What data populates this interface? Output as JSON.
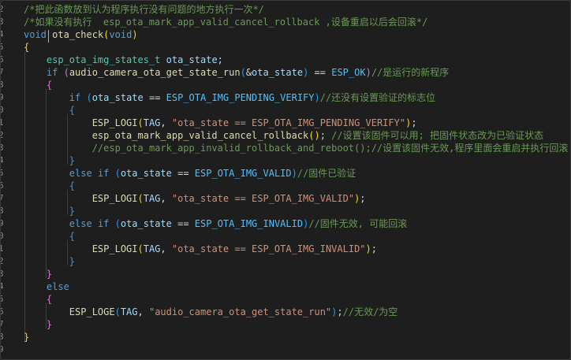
{
  "editor": {
    "language": "c",
    "function_name": "ota_check",
    "colors": {
      "background": "#1e1e1e",
      "keyword": "#569cd6",
      "function": "#dcdcaa",
      "type": "#4ec9b0",
      "variable": "#9cdcfe",
      "constant": "#4fc1ff",
      "string": "#ce9178",
      "comment": "#6a9955",
      "bracket_level1": "#ffd700",
      "bracket_level2": "#da70d6",
      "bracket_level3": "#179fff"
    },
    "gutter": [
      "2",
      "3",
      "4",
      "5",
      "6",
      "7",
      "8",
      "9",
      "0",
      "1",
      "2",
      "3",
      "4",
      "5",
      "6",
      "7",
      "8",
      "9",
      "0",
      "1",
      "2",
      "3",
      "4",
      "5",
      "6",
      "7",
      "8",
      "9"
    ],
    "lines": [
      [
        {
          "t": "/*把此函数放到认为程序执行没有问题的地方执行一次*/",
          "c": "cm"
        }
      ],
      [
        {
          "t": "/*如果没有执行  esp_ota_mark_app_valid_cancel_rollback ,设备重启以后会回滚*/",
          "c": "cm"
        }
      ],
      [
        {
          "t": "void",
          "c": "kw"
        },
        {
          "t": " "
        },
        {
          "t": "ota_check",
          "c": "fn"
        },
        {
          "t": "(",
          "c": "br1"
        },
        {
          "t": "void",
          "c": "kw"
        },
        {
          "t": ")",
          "c": "br1"
        }
      ],
      [
        {
          "t": "{",
          "c": "br1"
        }
      ],
      [
        {
          "t": "    "
        },
        {
          "t": "esp_ota_img_states_t",
          "c": "ty"
        },
        {
          "t": " "
        },
        {
          "t": "ota_state",
          "c": "var"
        },
        {
          "t": ";"
        }
      ],
      [
        {
          "t": "    "
        },
        {
          "t": "if",
          "c": "kw"
        },
        {
          "t": " "
        },
        {
          "t": "(",
          "c": "br2"
        },
        {
          "t": "audio_camera_ota_get_state_run",
          "c": "fn"
        },
        {
          "t": "(",
          "c": "br3"
        },
        {
          "t": "&"
        },
        {
          "t": "ota_state",
          "c": "var"
        },
        {
          "t": ")",
          "c": "br3"
        },
        {
          "t": " == "
        },
        {
          "t": "ESP_OK",
          "c": "mac"
        },
        {
          "t": ")",
          "c": "br2"
        },
        {
          "t": "//是运行的新程序",
          "c": "cm"
        }
      ],
      [
        {
          "t": "    "
        },
        {
          "t": "{",
          "c": "br2"
        }
      ],
      [
        {
          "t": "        "
        },
        {
          "t": "if",
          "c": "kw"
        },
        {
          "t": " "
        },
        {
          "t": "(",
          "c": "br3"
        },
        {
          "t": "ota_state",
          "c": "var"
        },
        {
          "t": " == "
        },
        {
          "t": "ESP_OTA_IMG_PENDING_VERIFY",
          "c": "mac"
        },
        {
          "t": ")",
          "c": "br3"
        },
        {
          "t": "//还没有设置验证的标志位",
          "c": "cm"
        }
      ],
      [
        {
          "t": "        "
        },
        {
          "t": "{",
          "c": "br3"
        }
      ],
      [
        {
          "t": "            "
        },
        {
          "t": "ESP_LOGI",
          "c": "fn"
        },
        {
          "t": "(",
          "c": "br1"
        },
        {
          "t": "TAG",
          "c": "var"
        },
        {
          "t": ", "
        },
        {
          "t": "\"ota_state == ESP_OTA_IMG_PENDING_VERIFY\"",
          "c": "str"
        },
        {
          "t": ")",
          "c": "br1"
        },
        {
          "t": ";"
        }
      ],
      [
        {
          "t": "            "
        },
        {
          "t": "esp_ota_mark_app_valid_cancel_rollback",
          "c": "fn"
        },
        {
          "t": "(",
          "c": "br1"
        },
        {
          "t": ")",
          "c": "br1"
        },
        {
          "t": "; "
        },
        {
          "t": "//设置该固件可以用; 把固件状态改为已验证状态",
          "c": "cm"
        }
      ],
      [
        {
          "t": "            "
        },
        {
          "t": "//esp_ota_mark_app_invalid_rollback_and_reboot();//设置该固件无效,程序里面会重启并执行回滚",
          "c": "cm"
        }
      ],
      [
        {
          "t": "        "
        },
        {
          "t": "}",
          "c": "br3"
        }
      ],
      [
        {
          "t": "        "
        },
        {
          "t": "else",
          "c": "kw"
        },
        {
          "t": " "
        },
        {
          "t": "if",
          "c": "kw"
        },
        {
          "t": " "
        },
        {
          "t": "(",
          "c": "br3"
        },
        {
          "t": "ota_state",
          "c": "var"
        },
        {
          "t": " == "
        },
        {
          "t": "ESP_OTA_IMG_VALID",
          "c": "mac"
        },
        {
          "t": ")",
          "c": "br3"
        },
        {
          "t": "//固件已验证",
          "c": "cm"
        }
      ],
      [
        {
          "t": "        "
        },
        {
          "t": "{",
          "c": "br3"
        }
      ],
      [
        {
          "t": "            "
        },
        {
          "t": "ESP_LOGI",
          "c": "fn"
        },
        {
          "t": "(",
          "c": "br1"
        },
        {
          "t": "TAG",
          "c": "var"
        },
        {
          "t": ", "
        },
        {
          "t": "\"ota_state == ESP_OTA_IMG_VALID\"",
          "c": "str"
        },
        {
          "t": ")",
          "c": "br1"
        },
        {
          "t": ";"
        }
      ],
      [
        {
          "t": "        "
        },
        {
          "t": "}",
          "c": "br3"
        }
      ],
      [
        {
          "t": "        "
        },
        {
          "t": "else",
          "c": "kw"
        },
        {
          "t": " "
        },
        {
          "t": "if",
          "c": "kw"
        },
        {
          "t": " "
        },
        {
          "t": "(",
          "c": "br3"
        },
        {
          "t": "ota_state",
          "c": "var"
        },
        {
          "t": " == "
        },
        {
          "t": "ESP_OTA_IMG_INVALID",
          "c": "mac"
        },
        {
          "t": ")",
          "c": "br3"
        },
        {
          "t": "//固件无效, 可能回滚",
          "c": "cm"
        }
      ],
      [
        {
          "t": "        "
        },
        {
          "t": "{",
          "c": "br3"
        }
      ],
      [
        {
          "t": "            "
        },
        {
          "t": "ESP_LOGI",
          "c": "fn"
        },
        {
          "t": "(",
          "c": "br1"
        },
        {
          "t": "TAG",
          "c": "var"
        },
        {
          "t": ", "
        },
        {
          "t": "\"ota_state == ESP_OTA_IMG_INVALID\"",
          "c": "str"
        },
        {
          "t": ")",
          "c": "br1"
        },
        {
          "t": ";"
        }
      ],
      [
        {
          "t": "        "
        },
        {
          "t": "}",
          "c": "br3"
        }
      ],
      [
        {
          "t": "    "
        },
        {
          "t": "}",
          "c": "br2"
        }
      ],
      [
        {
          "t": "    "
        },
        {
          "t": "else",
          "c": "kw"
        }
      ],
      [
        {
          "t": "    "
        },
        {
          "t": "{",
          "c": "br2"
        }
      ],
      [
        {
          "t": "        "
        },
        {
          "t": "ESP_LOGE",
          "c": "fn"
        },
        {
          "t": "(",
          "c": "br3"
        },
        {
          "t": "TAG",
          "c": "var"
        },
        {
          "t": ", "
        },
        {
          "t": "\"audio_camera_ota_get_state_run\"",
          "c": "str"
        },
        {
          "t": ")",
          "c": "br3"
        },
        {
          "t": ";"
        },
        {
          "t": "//无效/为空",
          "c": "cm"
        }
      ],
      [
        {
          "t": "    "
        },
        {
          "t": "}",
          "c": "br2"
        }
      ],
      [
        {
          "t": "}",
          "c": "br1"
        }
      ],
      [
        {
          "t": ""
        }
      ]
    ]
  }
}
